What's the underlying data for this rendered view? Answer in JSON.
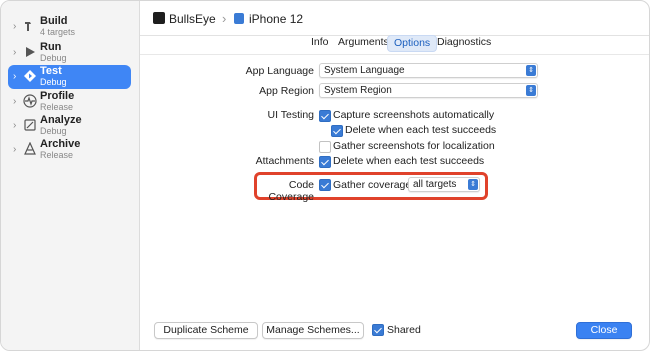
{
  "sidebar": {
    "items": [
      {
        "name": "Build",
        "sub": "4 targets",
        "icon": "hammer-icon"
      },
      {
        "name": "Run",
        "sub": "Debug",
        "icon": "play-icon"
      },
      {
        "name": "Test",
        "sub": "Debug",
        "icon": "test-diamond-icon"
      },
      {
        "name": "Profile",
        "sub": "Release",
        "icon": "waveform-icon"
      },
      {
        "name": "Analyze",
        "sub": "Debug",
        "icon": "analyze-icon"
      },
      {
        "name": "Archive",
        "sub": "Release",
        "icon": "archive-icon"
      }
    ],
    "selected_index": 2
  },
  "titlebar": {
    "scheme": "BullsEye",
    "separator": "›",
    "destination": "iPhone 12"
  },
  "tabs": [
    "Info",
    "Arguments",
    "Options",
    "Diagnostics"
  ],
  "active_tab": "Options",
  "options": {
    "app_language": {
      "label": "App Language",
      "value": "System Language"
    },
    "app_region": {
      "label": "App Region",
      "value": "System Region"
    },
    "ui_testing": {
      "label": "UI Testing",
      "capture": "Capture screenshots automatically",
      "delete": "Delete when each test succeeds",
      "gather": "Gather screenshots for localization"
    },
    "attachments": {
      "label": "Attachments",
      "delete": "Delete when each test succeeds"
    },
    "code_coverage": {
      "label": "Code Coverage",
      "gather": "Gather coverage for",
      "targets": "all targets"
    }
  },
  "footer": {
    "duplicate": "Duplicate Scheme",
    "manage": "Manage Schemes...",
    "shared": "Shared",
    "close": "Close"
  },
  "colors": {
    "accent": "#3a7bd5",
    "highlight": "#e0422b",
    "selected": "#3f86f5"
  }
}
